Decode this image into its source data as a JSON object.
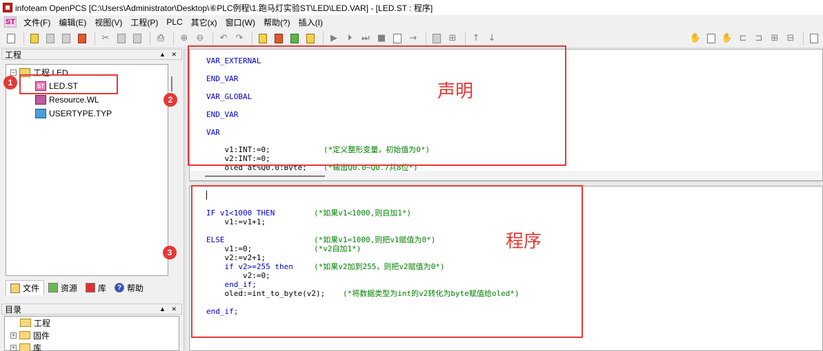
{
  "window": {
    "title": "infoteam OpenPCS [C:\\Users\\Administrator\\Desktop\\⑥PLC例程\\1.跑马灯实验ST\\LED\\LED.VAR] - [LED.ST : 程序]"
  },
  "menubar": {
    "logo": "ST",
    "items": [
      "文件(F)",
      "编辑(E)",
      "视图(V)",
      "工程(P)",
      "PLC",
      "其它(x)",
      "窗口(W)",
      "帮助(?)",
      "插入(I)"
    ]
  },
  "toolbar": {
    "icons": [
      "new-doc-icon",
      "open-folder-icon",
      "save-icon",
      "save-all-icon",
      "build-icon",
      "cut-icon",
      "copy-icon",
      "paste-icon",
      "print-icon",
      "zoom-in-icon",
      "zoom-out-icon",
      "undo-icon",
      "redo-icon",
      "compile-icon",
      "make-icon",
      "resource-icon",
      "download-icon",
      "run-icon",
      "step-icon",
      "step-over-icon",
      "stop-icon",
      "breakpoint-icon",
      "go-icon",
      "monitor-icon",
      "watch-icon",
      "up-arrow-icon",
      "down-arrow-icon"
    ]
  },
  "project_panel": {
    "header": "工程",
    "header_controls": "▲ ✕",
    "tree": {
      "root": "工程 LED",
      "children": [
        "LED.ST",
        "Resource.WL",
        "USERTYPE.TYP"
      ]
    },
    "tabs": [
      "文件",
      "资源",
      "库",
      "帮助"
    ]
  },
  "directory_panel": {
    "header": "目录",
    "header_controls": "▲ ✕",
    "items": [
      "工程",
      "固件",
      "库"
    ]
  },
  "declaration_code": {
    "lines": [
      {
        "kw": "VAR_EXTERNAL",
        "tx": "",
        "cm": ""
      },
      {
        "kw": "END_VAR",
        "tx": "",
        "cm": ""
      },
      {
        "kw": "VAR_GLOBAL",
        "tx": "",
        "cm": ""
      },
      {
        "kw": "END_VAR",
        "tx": "",
        "cm": ""
      },
      {
        "kw": "VAR",
        "tx": "",
        "cm": ""
      },
      {
        "kw": "",
        "tx": "    v1:INT:=0;",
        "cm": "(*定义整形变量，初始值为0*)"
      },
      {
        "kw": "",
        "tx": "    v2:INT:=0;",
        "cm": ""
      },
      {
        "kw": "",
        "tx": "    oled at%Q0.0:Byte;",
        "cm": "(*输出Q0.0~Q0.7共8位*)"
      }
    ]
  },
  "program_code": {
    "lines": [
      {
        "a": "IF v1<1000 THEN",
        "b": "(*如果v1<1000,则自加1*)"
      },
      {
        "a": "    v1:=v1+1;",
        "b": ""
      },
      {
        "a": "ELSE",
        "b": "(*如果v1=1000,则把v1赋值为0*)"
      },
      {
        "a": "    v1:=0;",
        "b": "(*v2自加1*)"
      },
      {
        "a": "    v2:=v2+1;",
        "b": ""
      },
      {
        "a": "    if v2>=255 then",
        "b": "(*如果v2加到255，则把v2赋值为0*)"
      },
      {
        "a": "        v2:=0;",
        "b": ""
      },
      {
        "a": "    end_if;",
        "b": ""
      },
      {
        "a": "    oled:=int_to_byte(v2);",
        "b": "(*将数据类型为int的v2转化为byte赋值给oled*)"
      },
      {
        "a": "end_if;",
        "b": ""
      }
    ]
  },
  "annotations": {
    "badge1": "1",
    "badge2": "2",
    "badge3": "3",
    "declaration_label": "声明",
    "program_label": "程序",
    "color": "#e53935"
  }
}
